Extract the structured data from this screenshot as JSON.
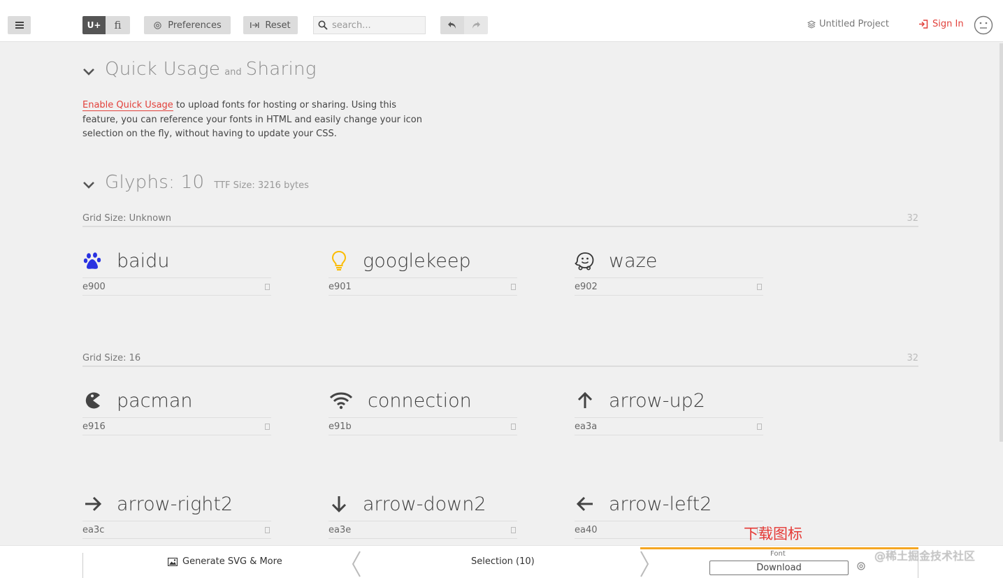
{
  "toolbar": {
    "uplus_label": "U+",
    "fi_label": "fi",
    "preferences_label": "Preferences",
    "reset_label": "Reset",
    "search_placeholder": "search...",
    "project_label": "Untitled Project",
    "signin_label": "Sign In"
  },
  "quick_usage": {
    "title": "Quick Usage",
    "and": "and",
    "title2": "Sharing",
    "link": "Enable Quick Usage",
    "text": " to upload fonts for hosting or sharing. Using this feature, you can reference your fonts in HTML and easily change your icon selection on the fly, without having to update your CSS."
  },
  "glyphs_header": {
    "title": "Glyphs: 10",
    "ttf_size": "TTF Size: 3216 bytes"
  },
  "groups": [
    {
      "grid_label": "Grid Size: Unknown",
      "size": "32",
      "glyphs": [
        {
          "name": "baidu",
          "code": "e900",
          "icon": "baidu-paw-icon",
          "color": "#2932e1"
        },
        {
          "name": "googlekeep",
          "code": "e901",
          "icon": "lightbulb-icon",
          "color": "#fbbc04"
        },
        {
          "name": "waze",
          "code": "e902",
          "icon": "waze-icon",
          "color": "#333333"
        }
      ]
    },
    {
      "grid_label": "Grid Size: 16",
      "size": "32",
      "glyphs": [
        {
          "name": "pacman",
          "code": "e916",
          "icon": "pacman-icon",
          "color": "#444444"
        },
        {
          "name": "connection",
          "code": "e91b",
          "icon": "wifi-icon",
          "color": "#444444"
        },
        {
          "name": "arrow-up2",
          "code": "ea3a",
          "icon": "arrow-up-icon",
          "color": "#444444"
        },
        {
          "name": "arrow-right2",
          "code": "ea3c",
          "icon": "arrow-right-icon",
          "color": "#444444"
        },
        {
          "name": "arrow-down2",
          "code": "ea3e",
          "icon": "arrow-down-icon",
          "color": "#444444"
        },
        {
          "name": "arrow-left2",
          "code": "ea40",
          "icon": "arrow-left-icon",
          "color": "#444444"
        }
      ]
    }
  ],
  "bottom": {
    "generate_label": "Generate SVG & More",
    "selection_label": "Selection (10)",
    "font_label": "Font",
    "download_label": "Download"
  },
  "annotation": "下载图标",
  "watermark": "@稀土掘金技术社区",
  "colors": {
    "accent": "#e2413b",
    "orange": "#f5a623",
    "annotation": "#e53935"
  }
}
